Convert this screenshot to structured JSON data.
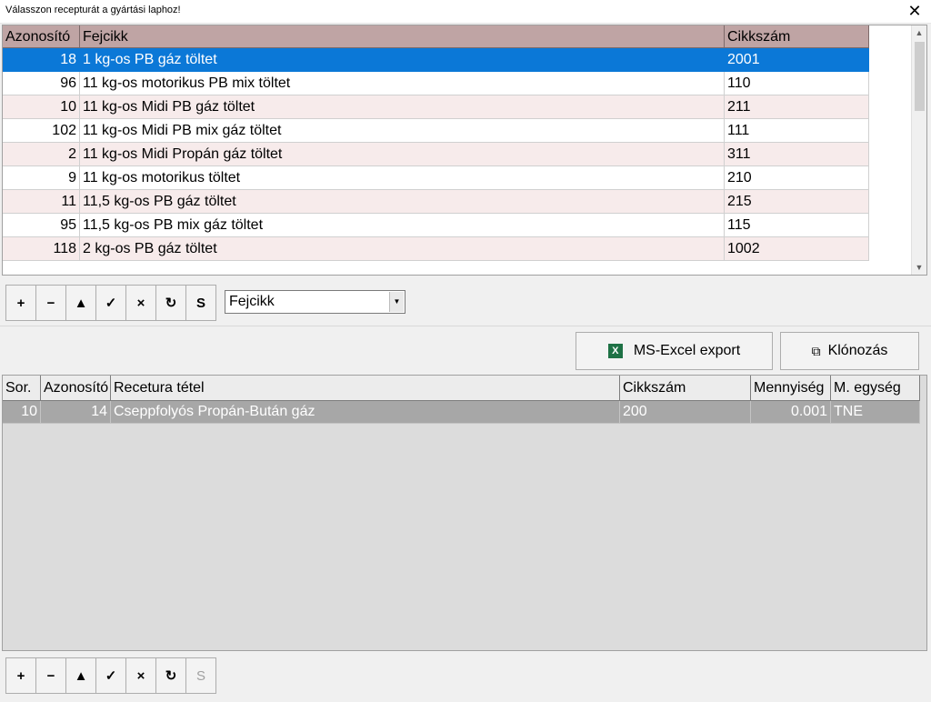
{
  "window": {
    "title": "Válasszon recepturát a gyártási laphoz!",
    "close": "✕"
  },
  "grid1": {
    "columns": [
      "Azonosító",
      "Fejcikk",
      "Cikkszám"
    ],
    "rows": [
      [
        "18",
        "1 kg-os PB gáz töltet",
        "2001"
      ],
      [
        "96",
        "11 kg-os  motorikus PB mix töltet",
        "110"
      ],
      [
        "10",
        "11 kg-os Midi PB gáz töltet",
        "211"
      ],
      [
        "102",
        "11 kg-os Midi PB mix gáz töltet",
        "111"
      ],
      [
        "2",
        "11 kg-os Midi Propán gáz töltet",
        "311"
      ],
      [
        "9",
        "11 kg-os motorikus töltet",
        "210"
      ],
      [
        "11",
        "11,5 kg-os PB gáz töltet",
        "215"
      ],
      [
        "95",
        "11,5 kg-os PB mix gáz töltet",
        "115"
      ],
      [
        "118",
        "2 kg-os PB gáz töltet",
        "1002"
      ]
    ],
    "selected_row": 0
  },
  "toolbar1": {
    "add": "+",
    "remove": "−",
    "up": "▲",
    "confirm": "✓",
    "cancel": "×",
    "refresh": "↻",
    "s": "S"
  },
  "field_select": {
    "value": "Fejcikk",
    "arrow": "▼"
  },
  "actions": {
    "excel_export": "MS-Excel export",
    "excel_icon": "X",
    "clone": "Klónozás",
    "clone_icon": "⧉"
  },
  "grid2": {
    "columns": [
      "Sor.",
      "Azonosító",
      "Recetura tétel",
      "Cikkszám",
      "Mennyiség",
      "M. egység"
    ],
    "rows": [
      [
        "10",
        "14",
        "Cseppfolyós Propán-Bután gáz",
        "200",
        "0.001",
        "TNE"
      ]
    ]
  },
  "toolbar2": {
    "add": "+",
    "remove": "−",
    "up": "▲",
    "confirm": "✓",
    "cancel": "×",
    "refresh": "↻",
    "s": "S"
  },
  "scroll": {
    "up": "▲",
    "down": "▼"
  },
  "colors": {
    "header1": "#bfa4a4",
    "selection": "#0b78d7",
    "row_alt": "#f7ebeb",
    "grid2_row": "#a7a7a7"
  }
}
